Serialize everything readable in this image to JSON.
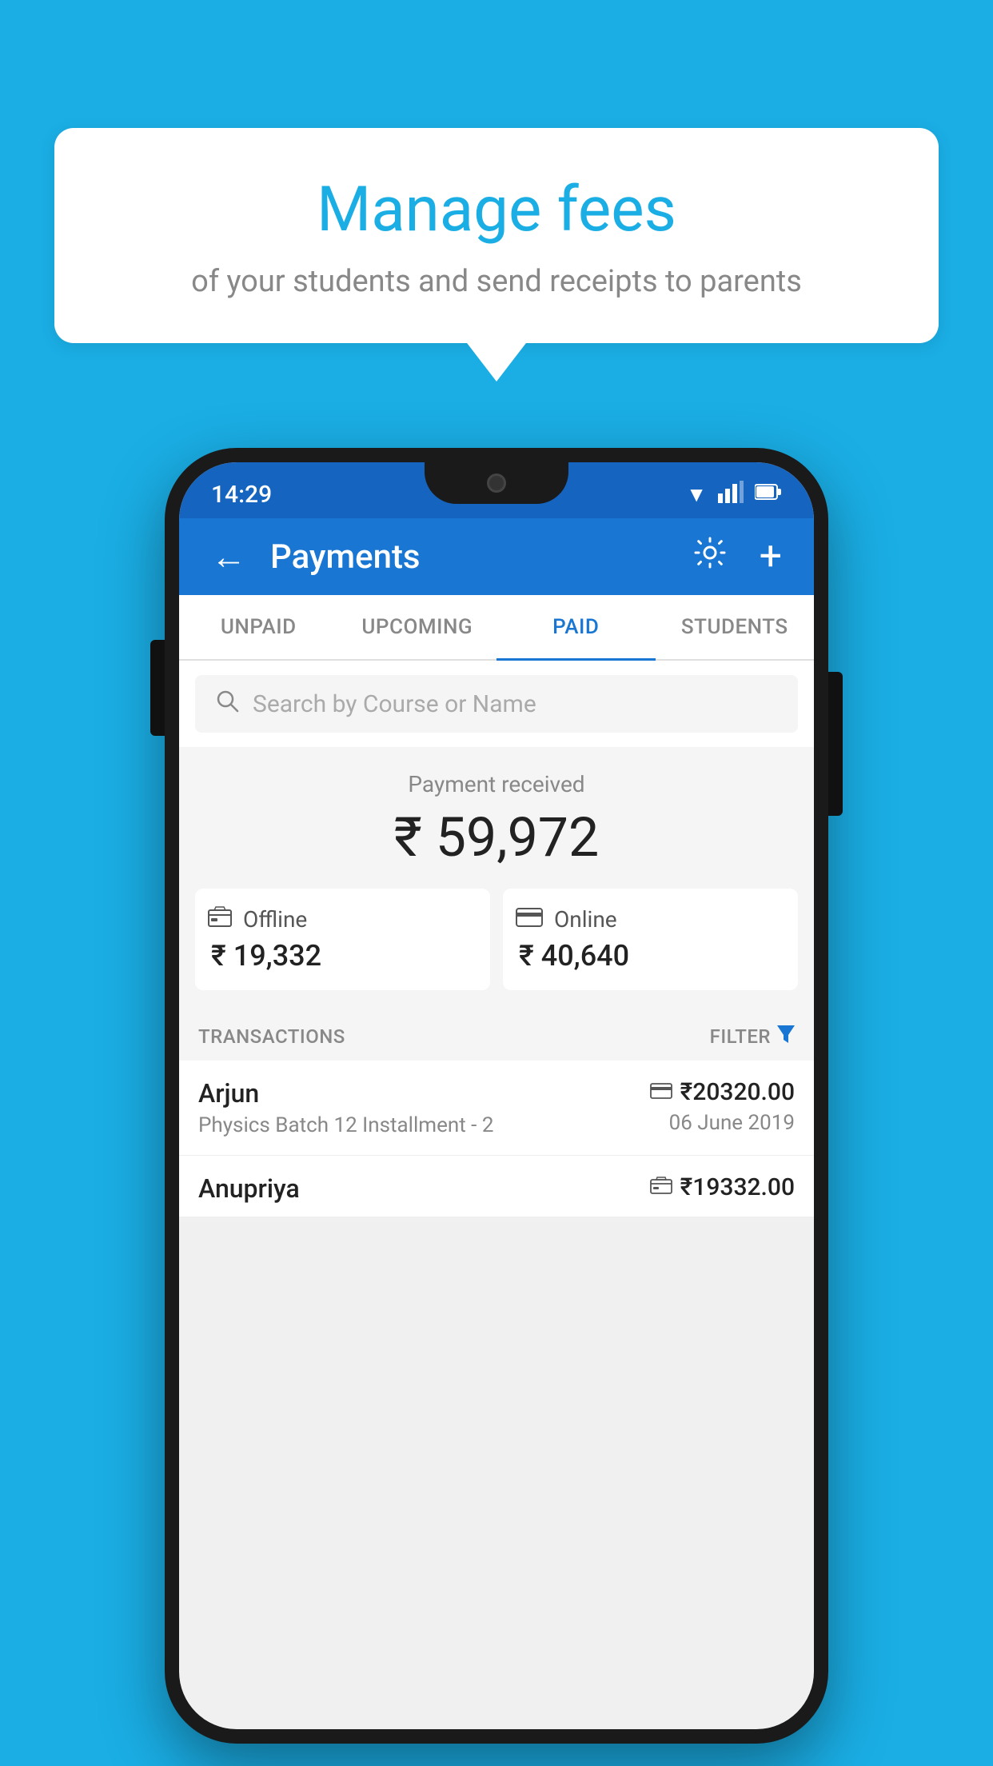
{
  "background_color": "#1AAEE5",
  "speech_bubble": {
    "title": "Manage fees",
    "subtitle": "of your students and send receipts to parents"
  },
  "status_bar": {
    "time": "14:29",
    "wifi": "▼",
    "signal": "▲",
    "battery": "▌"
  },
  "header": {
    "title": "Payments",
    "back_label": "←",
    "settings_label": "⚙",
    "add_label": "+"
  },
  "tabs": [
    {
      "id": "unpaid",
      "label": "UNPAID",
      "active": false
    },
    {
      "id": "upcoming",
      "label": "UPCOMING",
      "active": false
    },
    {
      "id": "paid",
      "label": "PAID",
      "active": true
    },
    {
      "id": "students",
      "label": "STUDENTS",
      "active": false
    }
  ],
  "search": {
    "placeholder": "Search by Course or Name"
  },
  "payment_summary": {
    "received_label": "Payment received",
    "total_amount": "₹ 59,972",
    "offline": {
      "label": "Offline",
      "amount": "₹ 19,332"
    },
    "online": {
      "label": "Online",
      "amount": "₹ 40,640"
    }
  },
  "transactions_section": {
    "label": "TRANSACTIONS",
    "filter_label": "FILTER"
  },
  "transactions": [
    {
      "name": "Arjun",
      "course": "Physics Batch 12 Installment - 2",
      "amount": "₹20320.00",
      "date": "06 June 2019",
      "payment_type": "card"
    },
    {
      "name": "Anupriya",
      "course": "",
      "amount": "₹19332.00",
      "date": "",
      "payment_type": "offline"
    }
  ]
}
